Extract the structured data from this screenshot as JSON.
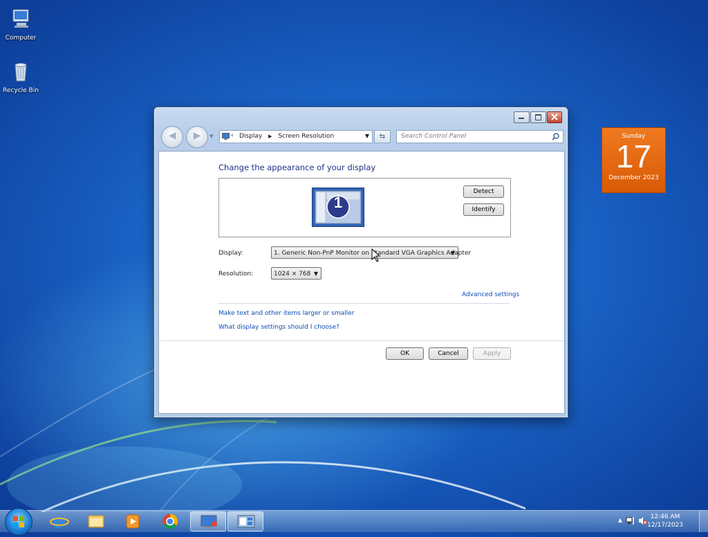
{
  "desktop": {
    "icons": [
      {
        "label": "Computer"
      },
      {
        "label": "Recycle Bin"
      }
    ]
  },
  "window": {
    "address": {
      "crumbs": [
        "Display",
        "Screen Resolution"
      ]
    },
    "search_placeholder": "Search Control Panel",
    "content": {
      "title": "Change the appearance of your display",
      "monitor_number": "1",
      "detect_label": "Detect",
      "identify_label": "Identify",
      "display_label": "Display:",
      "display_value": "1. Generic Non-PnP Monitor on Standard VGA Graphics Adapter",
      "resolution_label": "Resolution:",
      "resolution_value": "1024 × 768",
      "advanced_link": "Advanced settings",
      "link_text_size": "Make text and other items larger or smaller",
      "link_what_settings": "What display settings should I choose?",
      "ok_label": "OK",
      "cancel_label": "Cancel",
      "apply_label": "Apply"
    }
  },
  "calendar_gadget": {
    "weekday": "Sunday",
    "day": "17",
    "month_year": "December 2023"
  },
  "taskbar": {
    "apps": [
      "start-orb",
      "internet-explorer-icon",
      "windows-explorer-icon",
      "media-player-icon",
      "chrome-icon",
      "control-panel-icon",
      "display-settings-icon"
    ],
    "clock": {
      "time": "12:46 AM",
      "date": "12/17/2023"
    }
  },
  "colors": {
    "title_blue": "#1e3287",
    "link_blue": "#0b4cb4",
    "gadget_orange": "#e8690e",
    "desktop_blue": "#1a63c6"
  }
}
